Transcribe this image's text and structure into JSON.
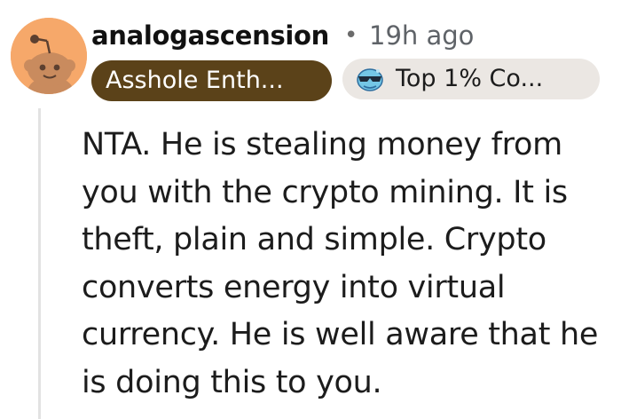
{
  "comment": {
    "author": "analogascension",
    "separator": "•",
    "timestamp": "19h ago",
    "user_flair": "Asshole Enth...",
    "achievement": {
      "label": "Top 1% Co...",
      "icon": "sunglasses-face-icon"
    },
    "avatar": {
      "icon": "reddit-snoo-avatar-icon",
      "background_color": "#f6a86a"
    },
    "body": "NTA. He is stealing money from you with the crypto mining. It is theft, plain and simple. Crypto converts energy into virtual currency. He is well aware that he is doing this to you."
  },
  "colors": {
    "flair_background": "#5b4219",
    "achievement_background": "#ebe7e3",
    "thread_line": "#e2e2e2",
    "text": "#1c1c1c",
    "meta_text": "#5f6368"
  }
}
